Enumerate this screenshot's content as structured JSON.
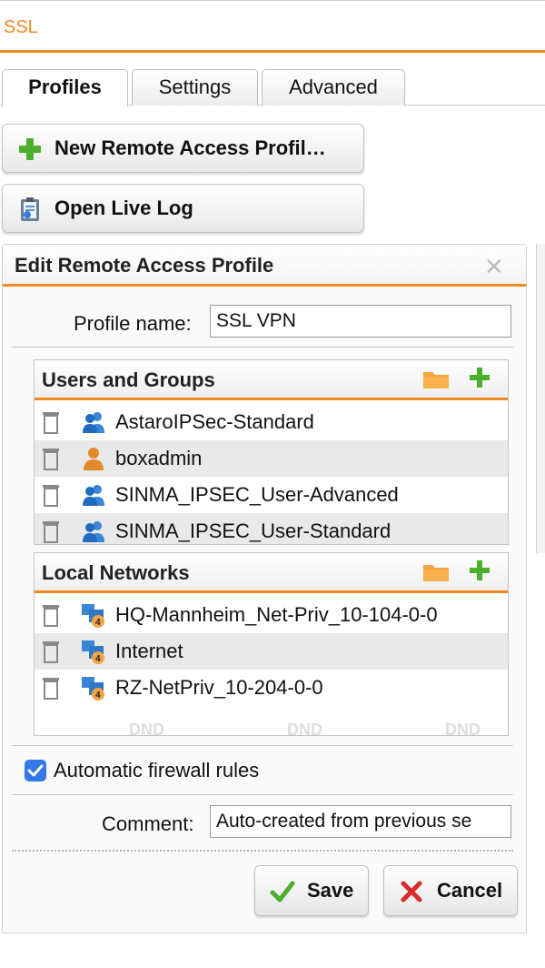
{
  "header": {
    "title": "SSL"
  },
  "tabs": [
    {
      "label": "Profiles",
      "active": true
    },
    {
      "label": "Settings",
      "active": false
    },
    {
      "label": "Advanced",
      "active": false
    }
  ],
  "actions": {
    "new_profile_label": "New Remote Access Profil…",
    "open_log_label": "Open Live Log"
  },
  "edit_panel": {
    "title": "Edit Remote Access Profile",
    "profile_name_label": "Profile name:",
    "profile_name_value": "SSL VPN",
    "users_groups": {
      "title": "Users and Groups",
      "items": [
        {
          "label": "AstaroIPSec-Standard",
          "icon": "group-icon"
        },
        {
          "label": "boxadmin",
          "icon": "user-icon"
        },
        {
          "label": "SINMA_IPSEC_User-Advanced",
          "icon": "group-icon"
        },
        {
          "label": "SINMA_IPSEC_User-Standard",
          "icon": "group-icon"
        }
      ]
    },
    "local_networks": {
      "title": "Local Networks",
      "items": [
        {
          "label": "HQ-Mannheim_Net-Priv_10-104-0-0",
          "icon": "network-icon"
        },
        {
          "label": "Internet",
          "icon": "network-icon"
        },
        {
          "label": "RZ-NetPriv_10-204-0-0",
          "icon": "network-icon"
        }
      ],
      "dnd_watermark": "DND"
    },
    "auto_firewall_label": "Automatic firewall rules",
    "auto_firewall_checked": true,
    "comment_label": "Comment:",
    "comment_value": "Auto-created from previous se",
    "save_label": "Save",
    "cancel_label": "Cancel"
  },
  "colors": {
    "accent": "#f08a24",
    "checkbox": "#3478e5",
    "plus_green": "#4caf2e",
    "cancel_red": "#d92c2c"
  }
}
